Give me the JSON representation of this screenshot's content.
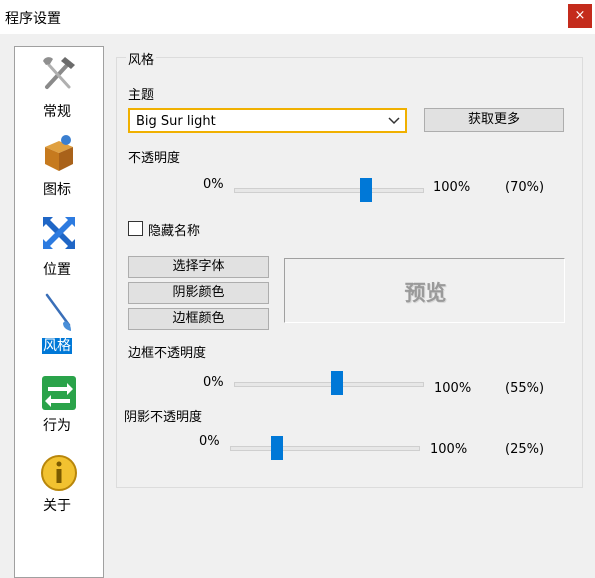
{
  "window": {
    "title": "程序设置",
    "close_label": "×"
  },
  "sidebar": {
    "items": [
      {
        "label": "常规",
        "icon": "tools-icon",
        "active": false
      },
      {
        "label": "图标",
        "icon": "box-icon",
        "active": false
      },
      {
        "label": "位置",
        "icon": "move-arrows-icon",
        "active": false
      },
      {
        "label": "风格",
        "icon": "brush-icon",
        "active": true
      },
      {
        "label": "行为",
        "icon": "exchange-arrows-icon",
        "active": false
      },
      {
        "label": "关于",
        "icon": "info-icon",
        "active": false
      }
    ]
  },
  "style_group": {
    "label": "风格",
    "theme_label": "主题",
    "theme_value": "Big Sur light",
    "get_more_button": "获取更多",
    "opacity": {
      "label": "不透明度",
      "min_label": "0%",
      "max_label": "100%",
      "value_label": "(70%)",
      "value": 70
    },
    "hide_name": {
      "label": "隐藏名称",
      "checked": false
    },
    "select_font_button": "选择字体",
    "shadow_color_button": "阴影颜色",
    "border_color_button": "边框颜色",
    "preview_text": "预览",
    "border_opacity": {
      "label": "边框不透明度",
      "min_label": "0%",
      "max_label": "100%",
      "value_label": "(55%)",
      "value": 55
    },
    "shadow_opacity": {
      "label": "阴影不透明度",
      "min_label": "0%",
      "max_label": "100%",
      "value_label": "(25%)",
      "value": 25
    }
  },
  "colors": {
    "accent": "#0078d7",
    "close": "#c42b1c",
    "focus": "#f0b000"
  }
}
